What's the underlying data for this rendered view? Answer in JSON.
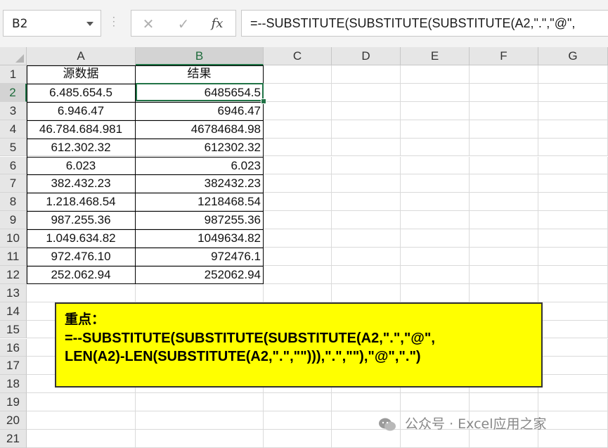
{
  "formula_bar": {
    "name_box": "B2",
    "cancel_icon": "✕",
    "enter_icon": "✓",
    "fx_label": "fx",
    "formula": "=--SUBSTITUTE(SUBSTITUTE(SUBSTITUTE(A2,\".\",\"@\","
  },
  "columns": [
    "A",
    "B",
    "C",
    "D",
    "E",
    "F",
    "G"
  ],
  "rows": [
    "1",
    "2",
    "3",
    "4",
    "5",
    "6",
    "7",
    "8",
    "9",
    "10",
    "11",
    "12",
    "13",
    "14",
    "15",
    "16",
    "17",
    "18",
    "19",
    "20",
    "21"
  ],
  "table": {
    "header": [
      "源数据",
      "结果"
    ],
    "data": [
      [
        "6.485.654.5",
        "6485654.5"
      ],
      [
        "6.946.47",
        "6946.47"
      ],
      [
        "46.784.684.981",
        "46784684.98"
      ],
      [
        "612.302.32",
        "612302.32"
      ],
      [
        "6.023",
        "6.023"
      ],
      [
        "382.432.23",
        "382432.23"
      ],
      [
        "1.218.468.54",
        "1218468.54"
      ],
      [
        "987.255.36",
        "987255.36"
      ],
      [
        "1.049.634.82",
        "1049634.82"
      ],
      [
        "972.476.10",
        "972476.1"
      ],
      [
        "252.062.94",
        "252062.94"
      ]
    ]
  },
  "note": {
    "title": "重点：",
    "line1": "=--SUBSTITUTE(SUBSTITUTE(SUBSTITUTE(A2,\".\",\"@\",",
    "line2": "LEN(A2)-LEN(SUBSTITUTE(A2,\".\",\"\"))),\".\",\"\"),\"@\",\".\")"
  },
  "watermark": "公众号 · Excel应用之家",
  "colors": {
    "accent": "#217346",
    "note_bg": "#ffff00"
  }
}
